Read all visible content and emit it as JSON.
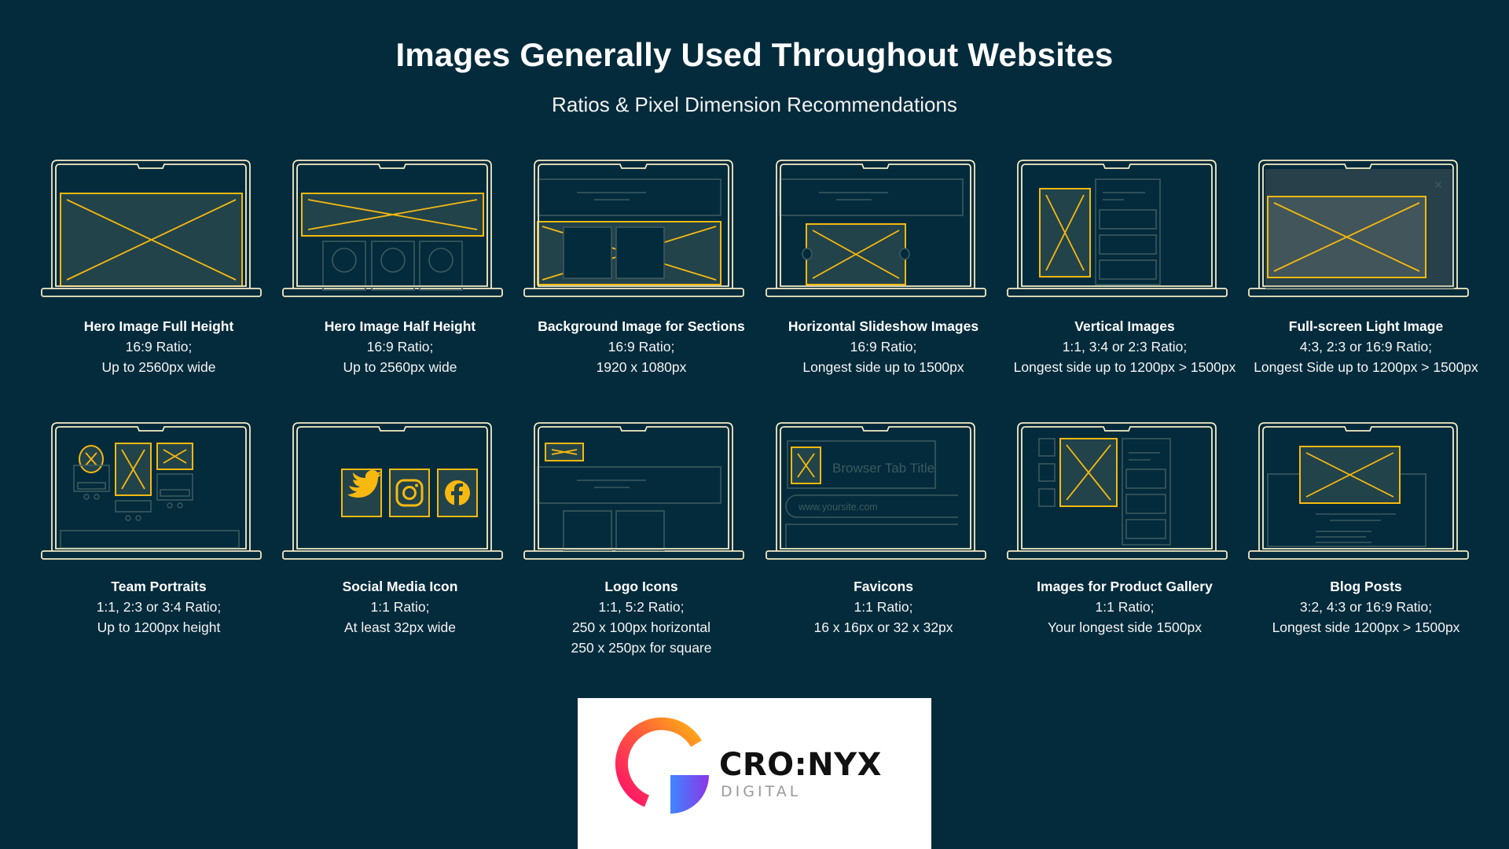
{
  "header": {
    "title": "Images Generally Used Throughout Websites",
    "subtitle": "Ratios & Pixel Dimension Recommendations"
  },
  "colors": {
    "background": "#042b3c",
    "laptop_outline": "#f5ecc4",
    "accent_yellow": "#f7b90f",
    "wire_gray": "#3b5a5e",
    "placeholder_fill": "#22434a"
  },
  "cards": [
    {
      "title": "Hero Image Full Height",
      "lines": [
        "16:9 Ratio;",
        "Up to 2560px wide"
      ]
    },
    {
      "title": "Hero Image Half Height",
      "lines": [
        "16:9 Ratio;",
        "Up to 2560px wide"
      ]
    },
    {
      "title": "Background Image for Sections",
      "lines": [
        "16:9 Ratio;",
        "1920 x 1080px"
      ]
    },
    {
      "title": "Horizontal Slideshow Images",
      "lines": [
        "16:9 Ratio;",
        "Longest side up to 1500px"
      ]
    },
    {
      "title": "Vertical Images",
      "lines": [
        "1:1, 3:4 or 2:3 Ratio;",
        "Longest side up to 1200px > 1500px"
      ]
    },
    {
      "title": "Full-screen Light Image",
      "lines": [
        "4:3, 2:3 or 16:9 Ratio;",
        "Longest Side up to 1200px > 1500px"
      ]
    },
    {
      "title": "Team Portraits",
      "lines": [
        "1:1, 2:3 or 3:4 Ratio;",
        "Up to 1200px height"
      ]
    },
    {
      "title": "Social Media Icon",
      "lines": [
        "1:1 Ratio;",
        "At least 32px wide"
      ]
    },
    {
      "title": "Logo Icons",
      "lines": [
        "1:1, 5:2 Ratio;",
        "250 x 100px horizontal",
        "250 x 250px for square"
      ]
    },
    {
      "title": "Favicons",
      "lines": [
        "1:1 Ratio;",
        "16 x 16px or 32 x 32px"
      ]
    },
    {
      "title": "Images for Product Gallery",
      "lines": [
        "1:1 Ratio;",
        "Your longest side 1500px"
      ]
    },
    {
      "title": "Blog Posts",
      "lines": [
        "3:2, 4:3 or 16:9 Ratio;",
        "Longest side 1200px > 1500px"
      ]
    }
  ],
  "mockups": {
    "fullscreen_close_glyph": "✕",
    "favicon_tab_title": "Browser Tab Title",
    "favicon_url": "www.yoursite.com",
    "social_icons": [
      "twitter-icon",
      "instagram-icon",
      "facebook-icon"
    ]
  },
  "logo": {
    "wordmark": "CRO:NYX",
    "subtext": "DIGITAL"
  }
}
